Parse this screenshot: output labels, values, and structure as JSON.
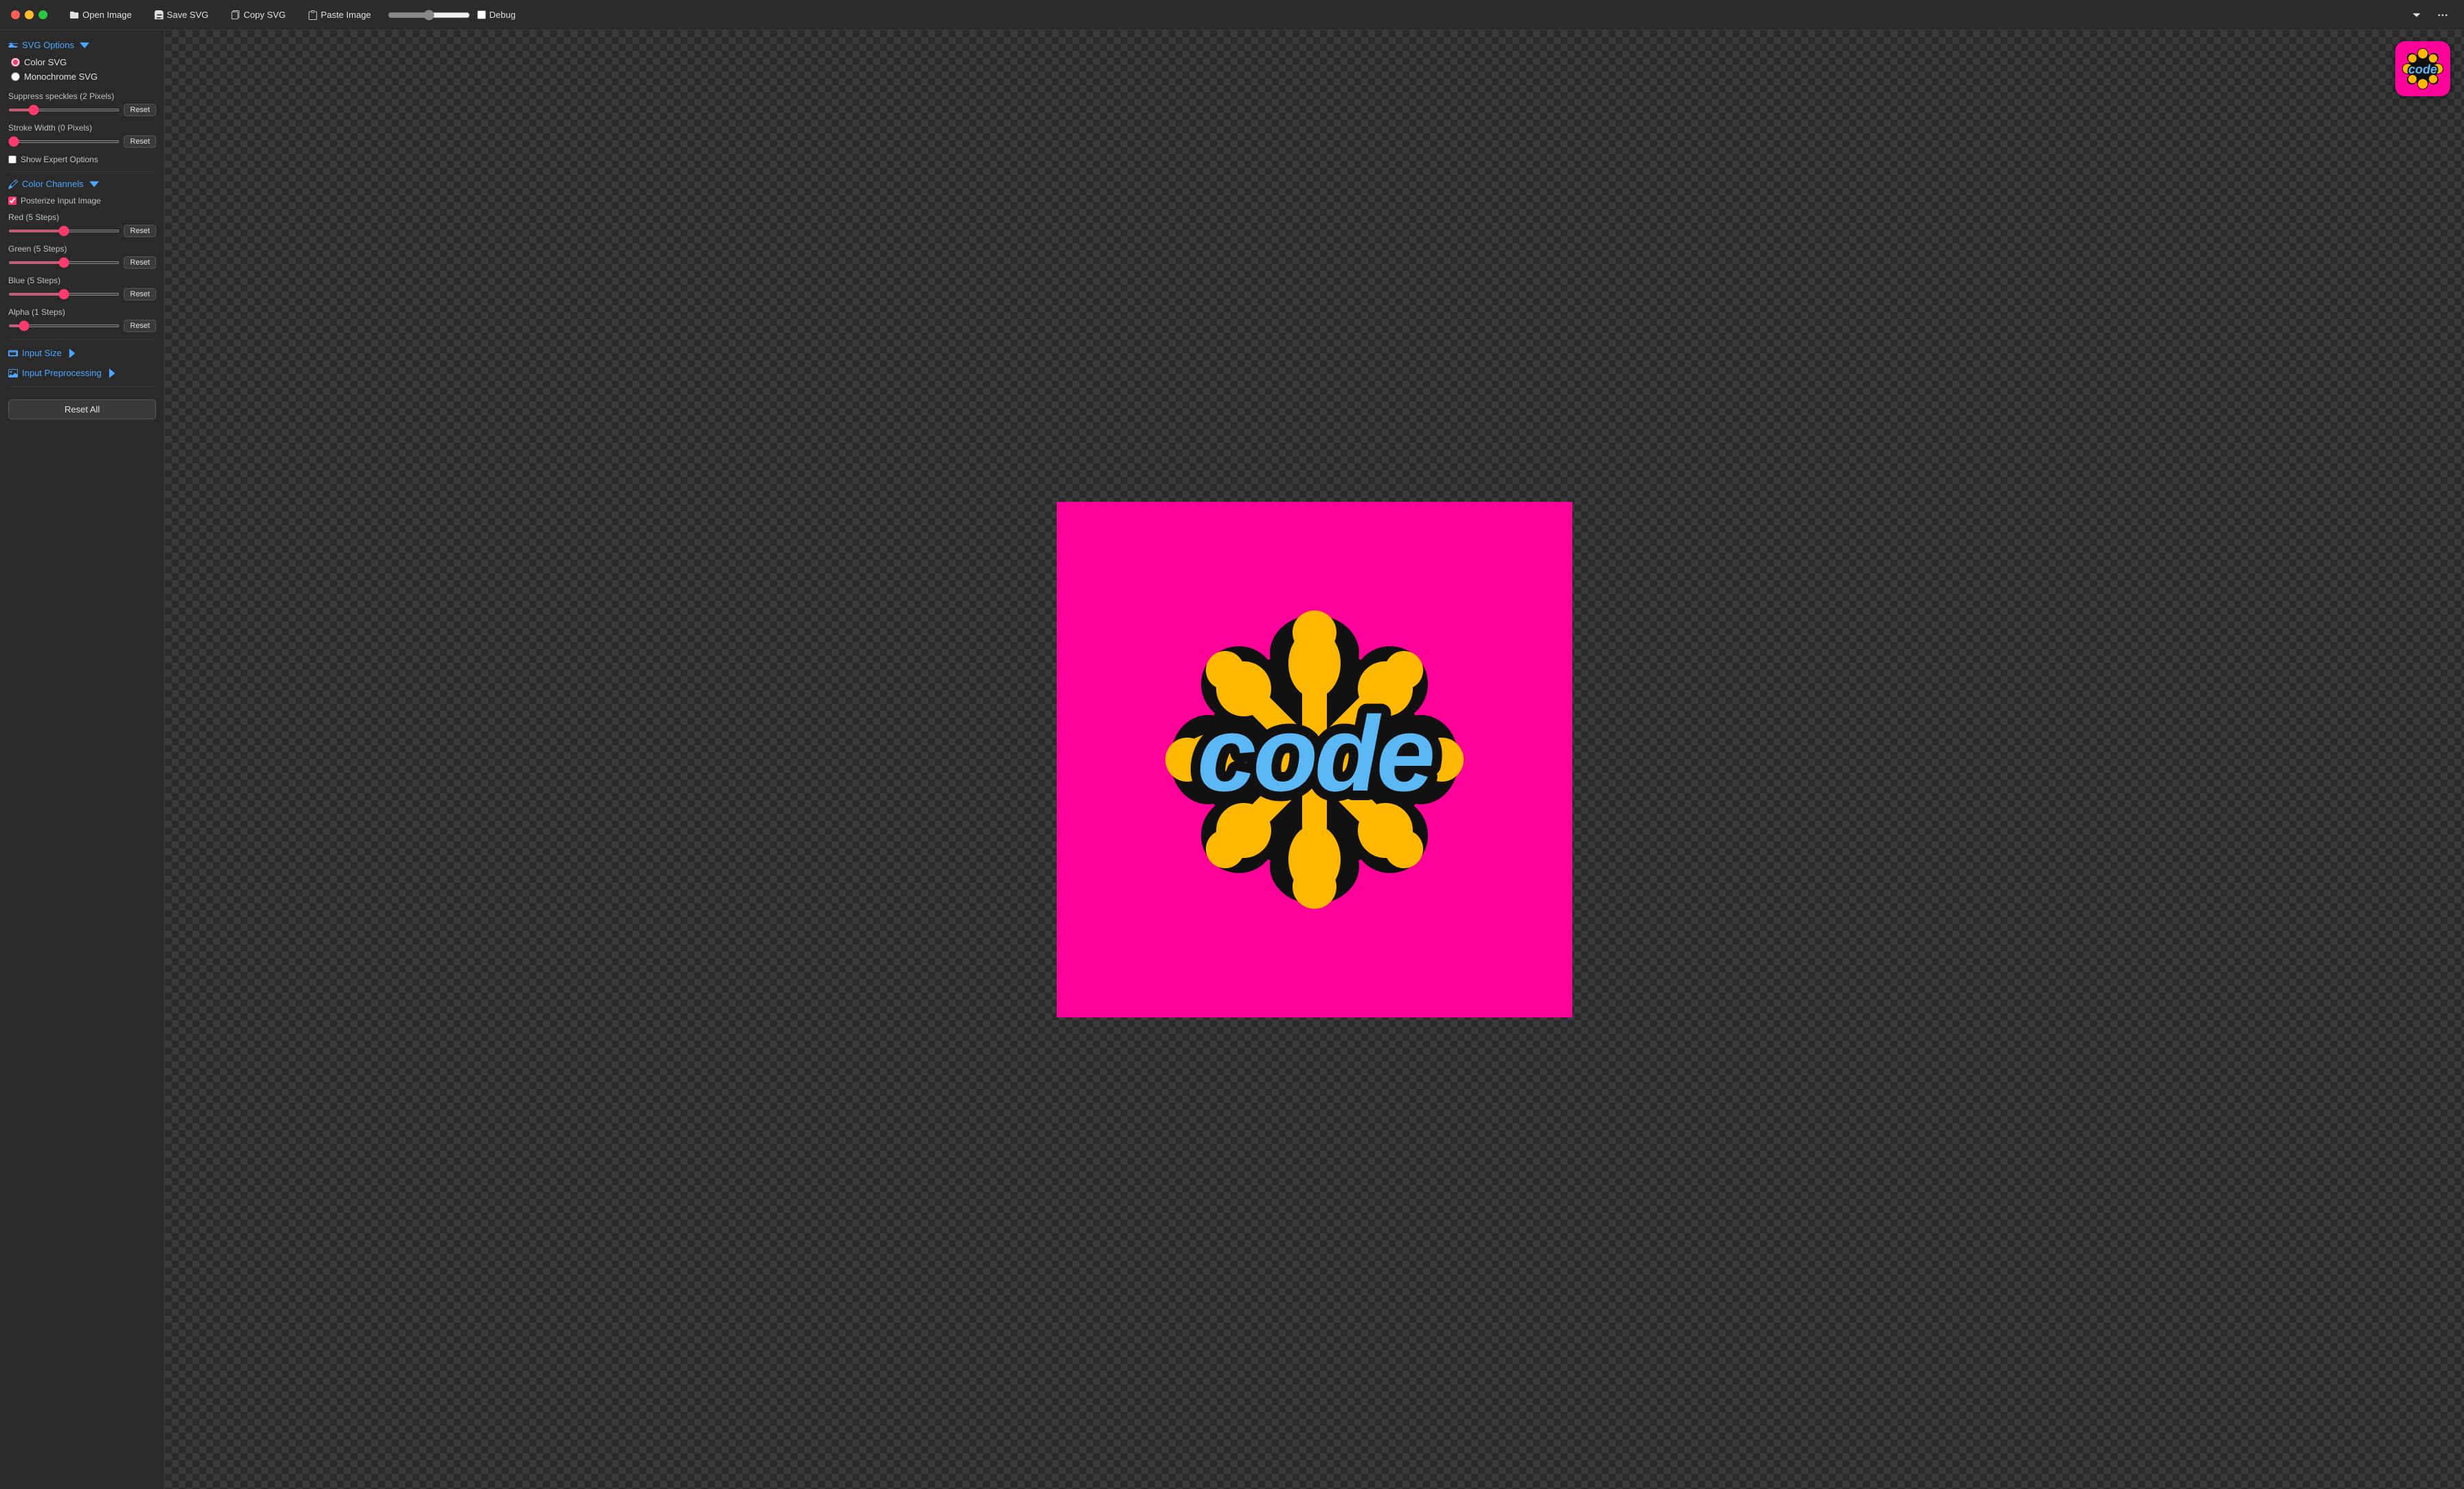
{
  "titlebar": {
    "open_image_label": "Open Image",
    "save_svg_label": "Save SVG",
    "copy_svg_label": "Copy SVG",
    "paste_image_label": "Paste Image",
    "debug_label": "Debug",
    "chevron_down": "chevron-down",
    "more": "more"
  },
  "sidebar": {
    "svg_options_label": "SVG Options",
    "color_svg_label": "Color SVG",
    "monochrome_svg_label": "Monochrome SVG",
    "suppress_speckles_label": "Suppress speckles (2 Pixels)",
    "stroke_width_label": "Stroke Width (0 Pixels)",
    "show_expert_options_label": "Show Expert Options",
    "color_channels_label": "Color Channels",
    "posterize_label": "Posterize Input Image",
    "red_label": "Red (5 Steps)",
    "green_label": "Green (5 Steps)",
    "blue_label": "Blue (5 Steps)",
    "alpha_label": "Alpha (1 Steps)",
    "input_size_label": "Input Size",
    "input_preprocessing_label": "Input Preprocessing",
    "reset_all_label": "Reset All",
    "reset_label": "Reset",
    "suppress_value": 2,
    "stroke_value": 0,
    "red_value": 50,
    "green_value": 45,
    "blue_value": 45,
    "alpha_value": 5
  }
}
